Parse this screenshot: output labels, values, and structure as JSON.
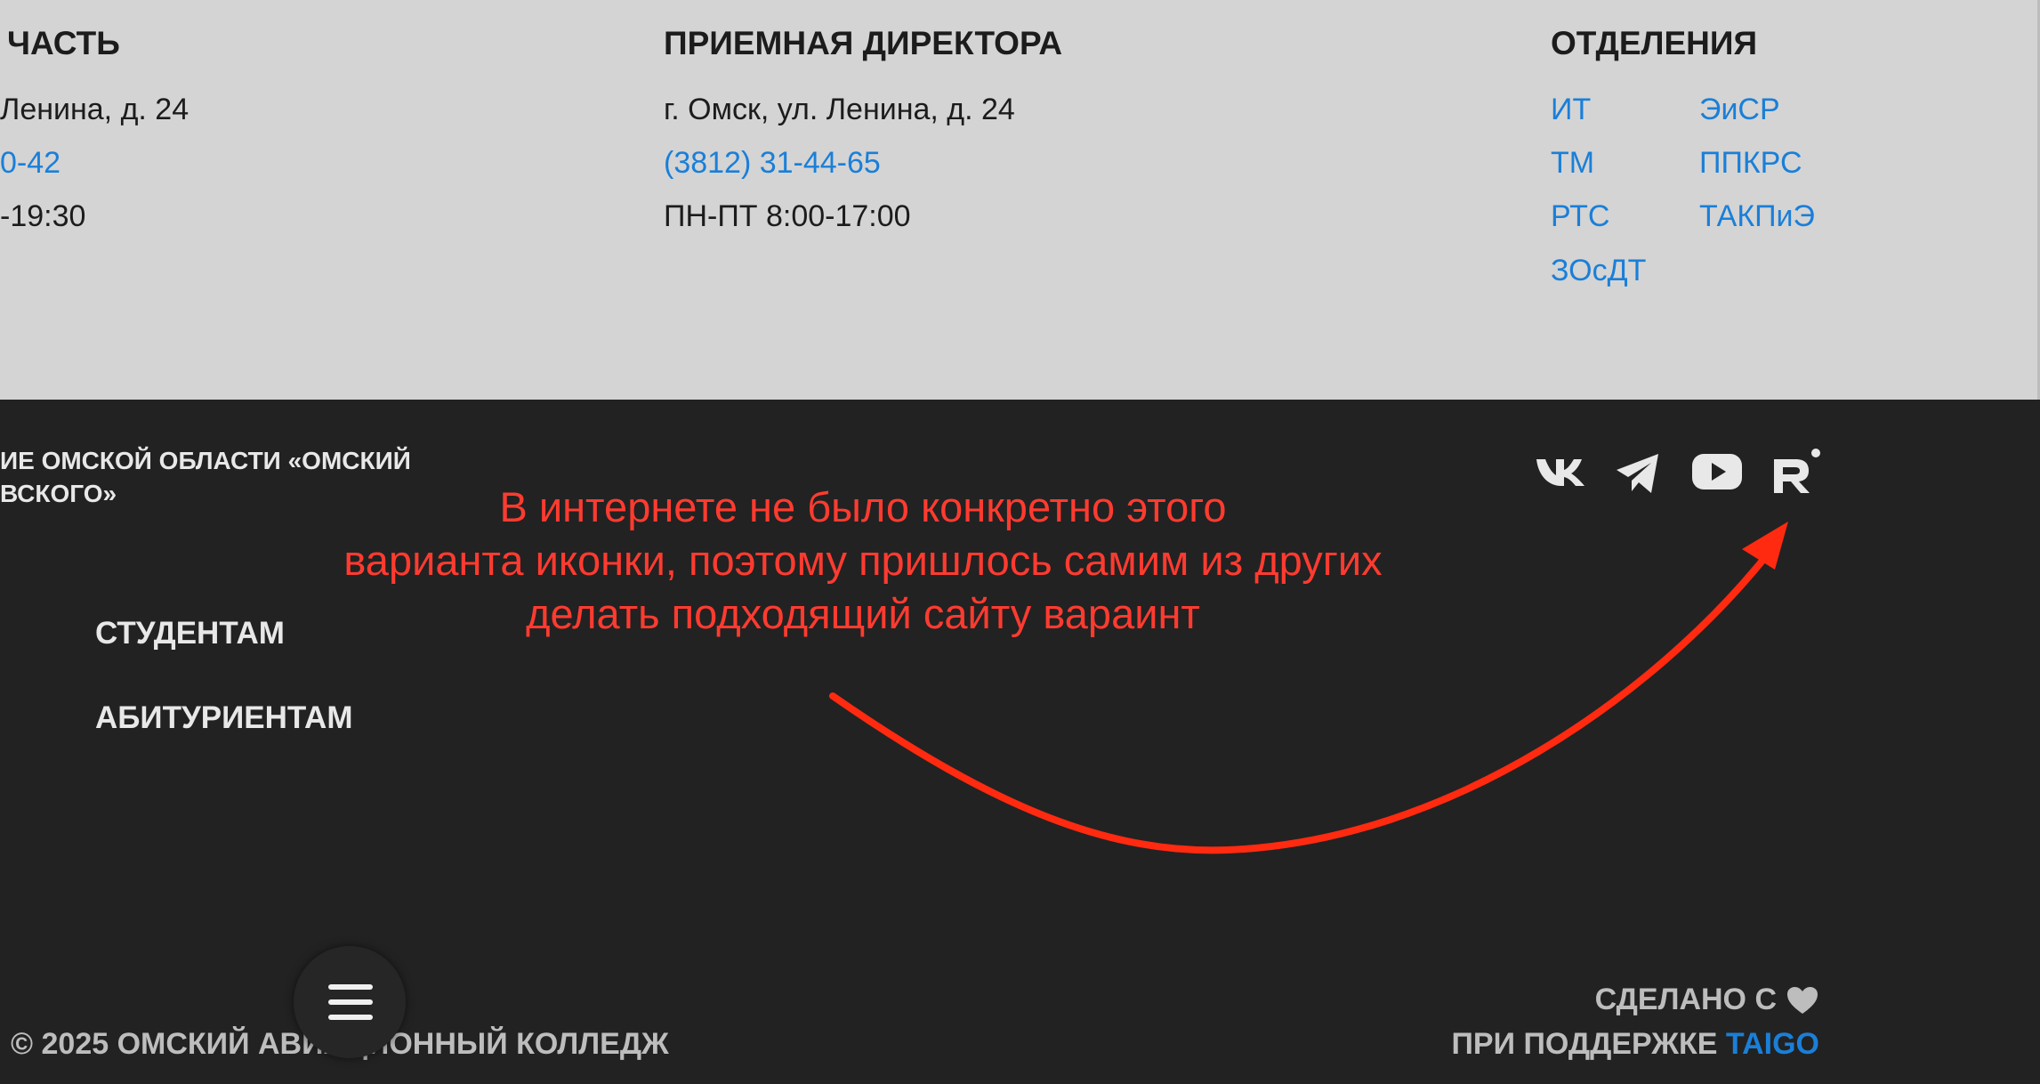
{
  "contacts": {
    "col1": {
      "title": "ЧАСТЬ",
      "address": "Ленина, д. 24",
      "phone": "0-42",
      "hours": "-19:30"
    },
    "col2": {
      "title": "ПРИЕМНАЯ ДИРЕКТОРА",
      "address": "г. Омск, ул. Ленина, д. 24",
      "phone": "(3812) 31-44-65",
      "hours": "ПН-ПТ 8:00-17:00"
    },
    "departments": {
      "title": "ОТДЕЛЕНИЯ",
      "left": [
        "ИТ",
        "ТМ",
        "РТС",
        "ЗОсДТ"
      ],
      "right": [
        "ЭиСР",
        "ППКРС",
        "ТАКПиЭ"
      ]
    }
  },
  "footer": {
    "org_line1": "ИЕ ОМСКОЙ ОБЛАСТИ «ОМСКИЙ",
    "org_line2": "ВСКОГО»",
    "nav": [
      "СТУДЕНТАМ",
      "АБИТУРИЕНТАМ"
    ],
    "social_icons": [
      "vk-icon",
      "telegram-icon",
      "youtube-icon",
      "rutube-icon"
    ],
    "copyright": "© 2025 ОМСКИЙ АВИАЦИОННЫЙ КОЛЛЕДЖ",
    "made_with": "СДЕЛАНО С",
    "support_prefix": "ПРИ ПОДДЕРЖКЕ",
    "support_link": "TAIGO"
  },
  "annotation": {
    "lines": [
      "В интернете не было конкретно этого",
      "варианта иконки, поэтому пришлось самим из других",
      "делать подходящий сайту вараинт"
    ]
  },
  "colors": {
    "top_bg": "#d4d4d4",
    "bottom_bg": "#222222",
    "link_blue": "#1a7fd8",
    "annotation_red": "#ff3b30"
  }
}
